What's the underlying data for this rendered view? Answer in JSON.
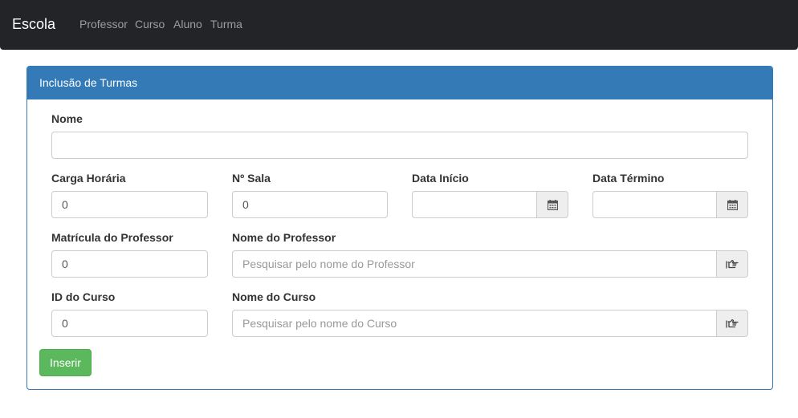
{
  "navbar": {
    "brand": "Escola",
    "links": [
      "Professor",
      "Curso",
      "Aluno",
      "Turma"
    ]
  },
  "panel": {
    "title": "Inclusão de Turmas"
  },
  "form": {
    "nome": {
      "label": "Nome",
      "value": ""
    },
    "carga_horaria": {
      "label": "Carga Horária",
      "value": "0"
    },
    "sala": {
      "label": "Nº Sala",
      "value": "0"
    },
    "data_inicio": {
      "label": "Data Início",
      "value": "",
      "icon": "calendar-icon"
    },
    "data_termino": {
      "label": "Data Término",
      "value": "",
      "icon": "calendar-icon"
    },
    "matricula_professor": {
      "label": "Matrícula do Professor",
      "value": "0"
    },
    "nome_professor": {
      "label": "Nome do Professor",
      "placeholder": "Pesquisar pelo nome do Professor",
      "icon": "hand-pointer-icon"
    },
    "id_curso": {
      "label": "ID do Curso",
      "value": "0"
    },
    "nome_curso": {
      "label": "Nome do Curso",
      "placeholder": "Pesquisar pelo nome do Curso",
      "icon": "hand-pointer-icon"
    }
  },
  "buttons": {
    "insert_label": "Inserir"
  },
  "colors": {
    "navbar_bg": "#222428",
    "panel_primary": "#337ab7",
    "success": "#5cb85c"
  }
}
